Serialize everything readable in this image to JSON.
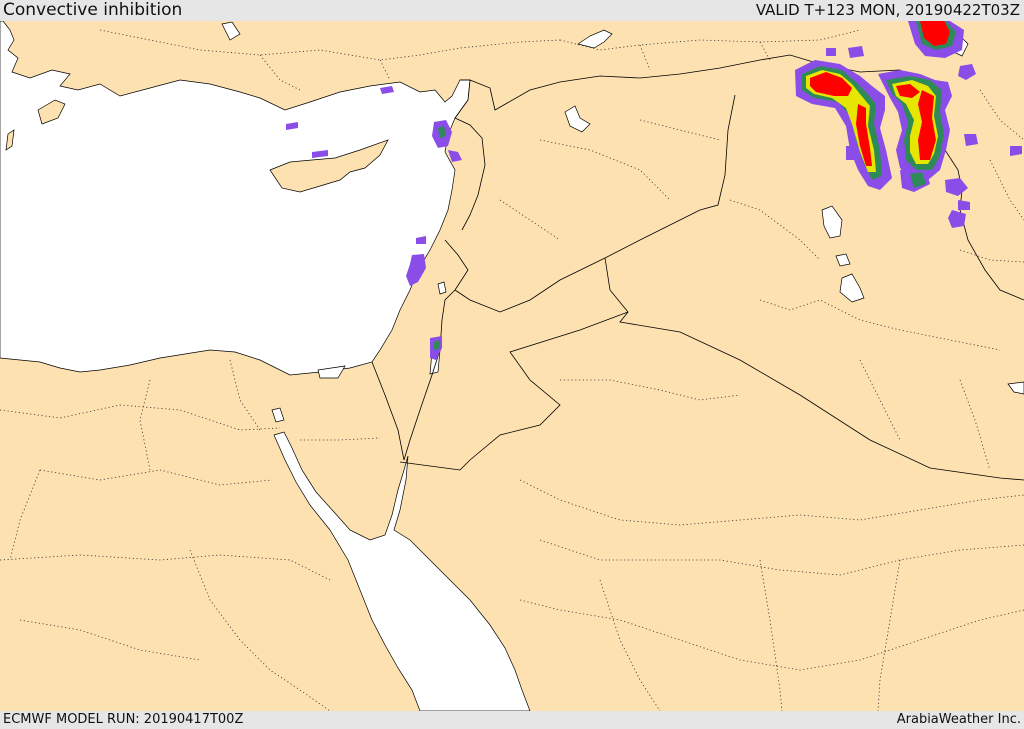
{
  "header": {
    "title": "Convective inhibition",
    "valid": "VALID T+123 MON, 20190422T03Z"
  },
  "footer": {
    "model_run": "ECMWF MODEL RUN: 20190417T00Z",
    "credit": "ArabiaWeather Inc."
  },
  "colors": {
    "land": "#fde1b0",
    "water": "#ffffff",
    "cin_low": "#8a4de8",
    "cin_mid": "#2e8b57",
    "cin_mid2": "#e6e600",
    "cin_high": "#ff0000"
  }
}
